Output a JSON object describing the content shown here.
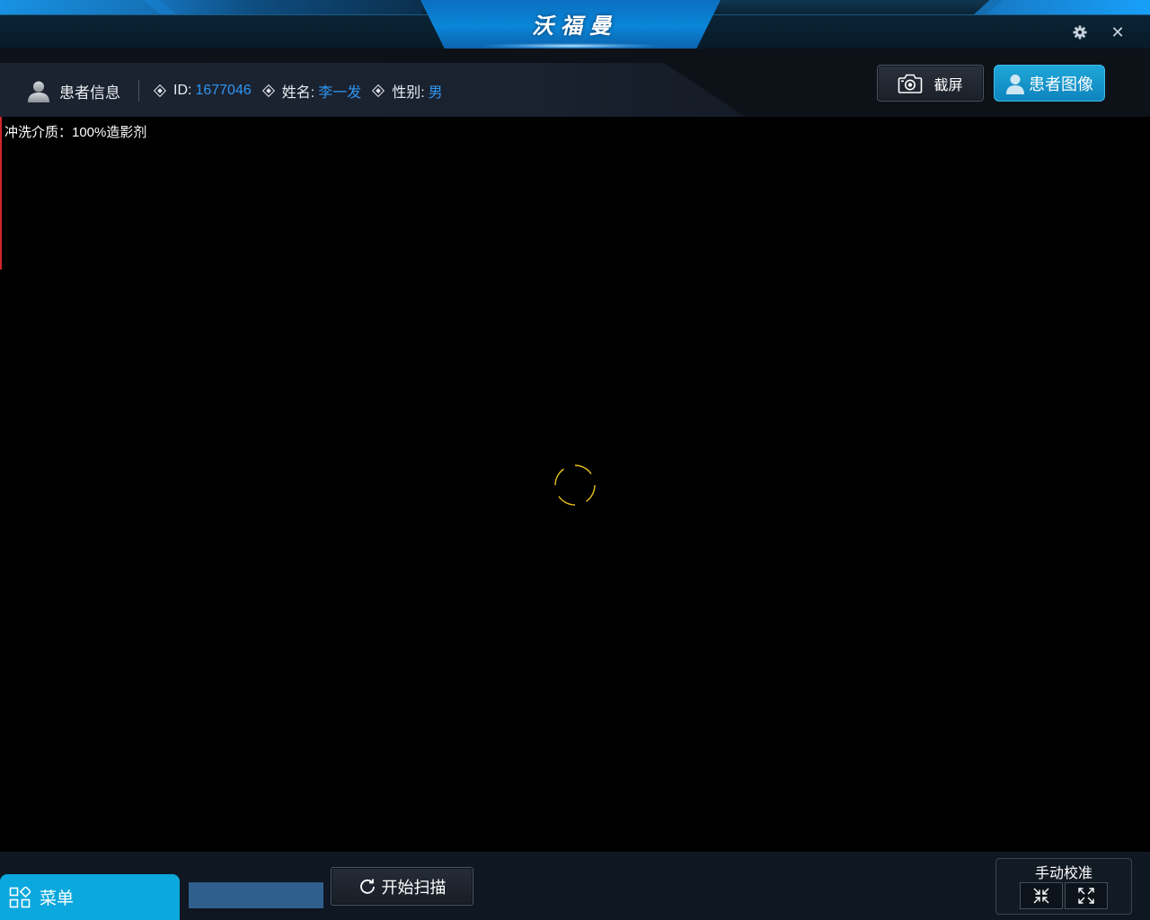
{
  "app": {
    "title": "沃福曼"
  },
  "window_controls": {
    "settings_icon": "gear-icon",
    "close_glyph": "✕"
  },
  "patient_info": {
    "section_title": "患者信息",
    "id_label": "ID:",
    "id_value": "1677046",
    "name_label": "姓名:",
    "name_value": "李一发",
    "gender_label": "性别:",
    "gender_value": "男"
  },
  "toolbar": {
    "screenshot_label": "截屏",
    "patient_image_label": "患者图像"
  },
  "viewport": {
    "flush_medium_text": "冲洗介质：100%造影剂"
  },
  "bottom": {
    "menu_label": "菜单",
    "scan_label": "开始扫描",
    "calibration_title": "手动校准",
    "progress_fraction": 0
  },
  "colors": {
    "accent_blue": "#0ba8de",
    "value_blue": "#2f95f0",
    "reticle_yellow": "#e8c21a",
    "marker_red": "#d0242c"
  }
}
